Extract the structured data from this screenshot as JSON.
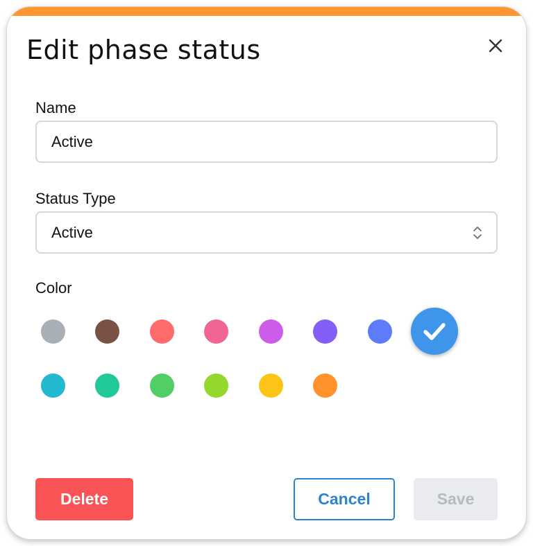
{
  "dialog": {
    "title": "Edit phase status",
    "accent_color": "#ff9731",
    "close_icon": "close-icon"
  },
  "name_field": {
    "label": "Name",
    "value": "Active"
  },
  "status_type_field": {
    "label": "Status Type",
    "selected": "Active",
    "icon": "chevron-up-down-icon"
  },
  "color_picker": {
    "label": "Color",
    "selected_index": 7,
    "selected_icon": "checkmark-icon",
    "colors": [
      "#a8afb7",
      "#7a5245",
      "#ff6b6b",
      "#f06595",
      "#cc5de8",
      "#845ef7",
      "#5c7cfa",
      "#3f95ea",
      "#22b8cf",
      "#20c997",
      "#51cf66",
      "#94d82d",
      "#fcc419",
      "#ff922b"
    ]
  },
  "buttons": {
    "delete_label": "Delete",
    "cancel_label": "Cancel",
    "save_label": "Save"
  }
}
